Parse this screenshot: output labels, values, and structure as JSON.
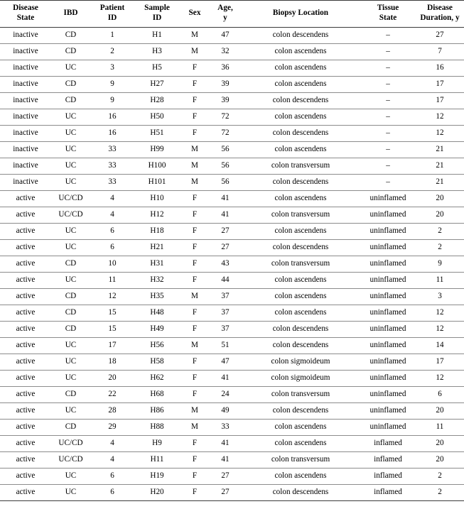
{
  "table": {
    "columns": [
      {
        "key": "disease_state",
        "label": "Disease State",
        "label_lines": [
          "Disease",
          "State"
        ]
      },
      {
        "key": "ibd",
        "label": "IBD",
        "label_lines": [
          "IBD"
        ]
      },
      {
        "key": "patient_id",
        "label": "Patient ID",
        "label_lines": [
          "Patient",
          "ID"
        ]
      },
      {
        "key": "sample_id",
        "label": "Sample ID",
        "label_lines": [
          "Sample",
          "ID"
        ]
      },
      {
        "key": "sex",
        "label": "Sex",
        "label_lines": [
          "Sex"
        ]
      },
      {
        "key": "age_y",
        "label": "Age, y",
        "label_lines": [
          "Age,",
          "y"
        ]
      },
      {
        "key": "biopsy_location",
        "label": "Biopsy Location",
        "label_lines": [
          "Biopsy Location"
        ]
      },
      {
        "key": "tissue_state",
        "label": "Tissue State",
        "label_lines": [
          "Tissue",
          "State"
        ]
      },
      {
        "key": "disease_duration",
        "label": "Disease Duration, y",
        "label_lines": [
          "Disease",
          "Duration, y"
        ]
      }
    ],
    "rows": [
      {
        "disease_state": "inactive",
        "ibd": "CD",
        "patient_id": "1",
        "sample_id": "H1",
        "sex": "M",
        "age_y": "47",
        "biopsy_location": "colon descendens",
        "tissue_state": "–",
        "disease_duration": "27"
      },
      {
        "disease_state": "inactive",
        "ibd": "CD",
        "patient_id": "2",
        "sample_id": "H3",
        "sex": "M",
        "age_y": "32",
        "biopsy_location": "colon ascendens",
        "tissue_state": "–",
        "disease_duration": "7"
      },
      {
        "disease_state": "inactive",
        "ibd": "UC",
        "patient_id": "3",
        "sample_id": "H5",
        "sex": "F",
        "age_y": "36",
        "biopsy_location": "colon ascendens",
        "tissue_state": "–",
        "disease_duration": "16"
      },
      {
        "disease_state": "inactive",
        "ibd": "CD",
        "patient_id": "9",
        "sample_id": "H27",
        "sex": "F",
        "age_y": "39",
        "biopsy_location": "colon ascendens",
        "tissue_state": "–",
        "disease_duration": "17"
      },
      {
        "disease_state": "inactive",
        "ibd": "CD",
        "patient_id": "9",
        "sample_id": "H28",
        "sex": "F",
        "age_y": "39",
        "biopsy_location": "colon descendens",
        "tissue_state": "–",
        "disease_duration": "17"
      },
      {
        "disease_state": "inactive",
        "ibd": "UC",
        "patient_id": "16",
        "sample_id": "H50",
        "sex": "F",
        "age_y": "72",
        "biopsy_location": "colon ascendens",
        "tissue_state": "–",
        "disease_duration": "12"
      },
      {
        "disease_state": "inactive",
        "ibd": "UC",
        "patient_id": "16",
        "sample_id": "H51",
        "sex": "F",
        "age_y": "72",
        "biopsy_location": "colon descendens",
        "tissue_state": "–",
        "disease_duration": "12"
      },
      {
        "disease_state": "inactive",
        "ibd": "UC",
        "patient_id": "33",
        "sample_id": "H99",
        "sex": "M",
        "age_y": "56",
        "biopsy_location": "colon ascendens",
        "tissue_state": "–",
        "disease_duration": "21"
      },
      {
        "disease_state": "inactive",
        "ibd": "UC",
        "patient_id": "33",
        "sample_id": "H100",
        "sex": "M",
        "age_y": "56",
        "biopsy_location": "colon transversum",
        "tissue_state": "–",
        "disease_duration": "21"
      },
      {
        "disease_state": "inactive",
        "ibd": "UC",
        "patient_id": "33",
        "sample_id": "H101",
        "sex": "M",
        "age_y": "56",
        "biopsy_location": "colon descendens",
        "tissue_state": "–",
        "disease_duration": "21"
      },
      {
        "disease_state": "active",
        "ibd": "UC/CD",
        "patient_id": "4",
        "sample_id": "H10",
        "sex": "F",
        "age_y": "41",
        "biopsy_location": "colon ascendens",
        "tissue_state": "uninflamed",
        "disease_duration": "20"
      },
      {
        "disease_state": "active",
        "ibd": "UC/CD",
        "patient_id": "4",
        "sample_id": "H12",
        "sex": "F",
        "age_y": "41",
        "biopsy_location": "colon transversum",
        "tissue_state": "uninflamed",
        "disease_duration": "20"
      },
      {
        "disease_state": "active",
        "ibd": "UC",
        "patient_id": "6",
        "sample_id": "H18",
        "sex": "F",
        "age_y": "27",
        "biopsy_location": "colon ascendens",
        "tissue_state": "uninflamed",
        "disease_duration": "2"
      },
      {
        "disease_state": "active",
        "ibd": "UC",
        "patient_id": "6",
        "sample_id": "H21",
        "sex": "F",
        "age_y": "27",
        "biopsy_location": "colon descendens",
        "tissue_state": "uninflamed",
        "disease_duration": "2"
      },
      {
        "disease_state": "active",
        "ibd": "CD",
        "patient_id": "10",
        "sample_id": "H31",
        "sex": "F",
        "age_y": "43",
        "biopsy_location": "colon transversum",
        "tissue_state": "uninflamed",
        "disease_duration": "9"
      },
      {
        "disease_state": "active",
        "ibd": "UC",
        "patient_id": "11",
        "sample_id": "H32",
        "sex": "F",
        "age_y": "44",
        "biopsy_location": "colon ascendens",
        "tissue_state": "uninflamed",
        "disease_duration": "11"
      },
      {
        "disease_state": "active",
        "ibd": "CD",
        "patient_id": "12",
        "sample_id": "H35",
        "sex": "M",
        "age_y": "37",
        "biopsy_location": "colon ascendens",
        "tissue_state": "uninflamed",
        "disease_duration": "3"
      },
      {
        "disease_state": "active",
        "ibd": "CD",
        "patient_id": "15",
        "sample_id": "H48",
        "sex": "F",
        "age_y": "37",
        "biopsy_location": "colon ascendens",
        "tissue_state": "uninflamed",
        "disease_duration": "12"
      },
      {
        "disease_state": "active",
        "ibd": "CD",
        "patient_id": "15",
        "sample_id": "H49",
        "sex": "F",
        "age_y": "37",
        "biopsy_location": "colon descendens",
        "tissue_state": "uninflamed",
        "disease_duration": "12"
      },
      {
        "disease_state": "active",
        "ibd": "UC",
        "patient_id": "17",
        "sample_id": "H56",
        "sex": "M",
        "age_y": "51",
        "biopsy_location": "colon descendens",
        "tissue_state": "uninflamed",
        "disease_duration": "14"
      },
      {
        "disease_state": "active",
        "ibd": "UC",
        "patient_id": "18",
        "sample_id": "H58",
        "sex": "F",
        "age_y": "47",
        "biopsy_location": "colon sigmoideum",
        "tissue_state": "uninflamed",
        "disease_duration": "17"
      },
      {
        "disease_state": "active",
        "ibd": "UC",
        "patient_id": "20",
        "sample_id": "H62",
        "sex": "F",
        "age_y": "41",
        "biopsy_location": "colon sigmoideum",
        "tissue_state": "uninflamed",
        "disease_duration": "12"
      },
      {
        "disease_state": "active",
        "ibd": "CD",
        "patient_id": "22",
        "sample_id": "H68",
        "sex": "F",
        "age_y": "24",
        "biopsy_location": "colon transversum",
        "tissue_state": "uninflamed",
        "disease_duration": "6"
      },
      {
        "disease_state": "active",
        "ibd": "UC",
        "patient_id": "28",
        "sample_id": "H86",
        "sex": "M",
        "age_y": "49",
        "biopsy_location": "colon descendens",
        "tissue_state": "uninflamed",
        "disease_duration": "20"
      },
      {
        "disease_state": "active",
        "ibd": "CD",
        "patient_id": "29",
        "sample_id": "H88",
        "sex": "M",
        "age_y": "33",
        "biopsy_location": "colon ascendens",
        "tissue_state": "uninflamed",
        "disease_duration": "11"
      },
      {
        "disease_state": "active",
        "ibd": "UC/CD",
        "patient_id": "4",
        "sample_id": "H9",
        "sex": "F",
        "age_y": "41",
        "biopsy_location": "colon ascendens",
        "tissue_state": "inflamed",
        "disease_duration": "20"
      },
      {
        "disease_state": "active",
        "ibd": "UC/CD",
        "patient_id": "4",
        "sample_id": "H11",
        "sex": "F",
        "age_y": "41",
        "biopsy_location": "colon transversum",
        "tissue_state": "inflamed",
        "disease_duration": "20"
      },
      {
        "disease_state": "active",
        "ibd": "UC",
        "patient_id": "6",
        "sample_id": "H19",
        "sex": "F",
        "age_y": "27",
        "biopsy_location": "colon ascendens",
        "tissue_state": "inflamed",
        "disease_duration": "2"
      },
      {
        "disease_state": "active",
        "ibd": "UC",
        "patient_id": "6",
        "sample_id": "H20",
        "sex": "F",
        "age_y": "27",
        "biopsy_location": "colon descendens",
        "tissue_state": "inflamed",
        "disease_duration": "2"
      }
    ]
  }
}
